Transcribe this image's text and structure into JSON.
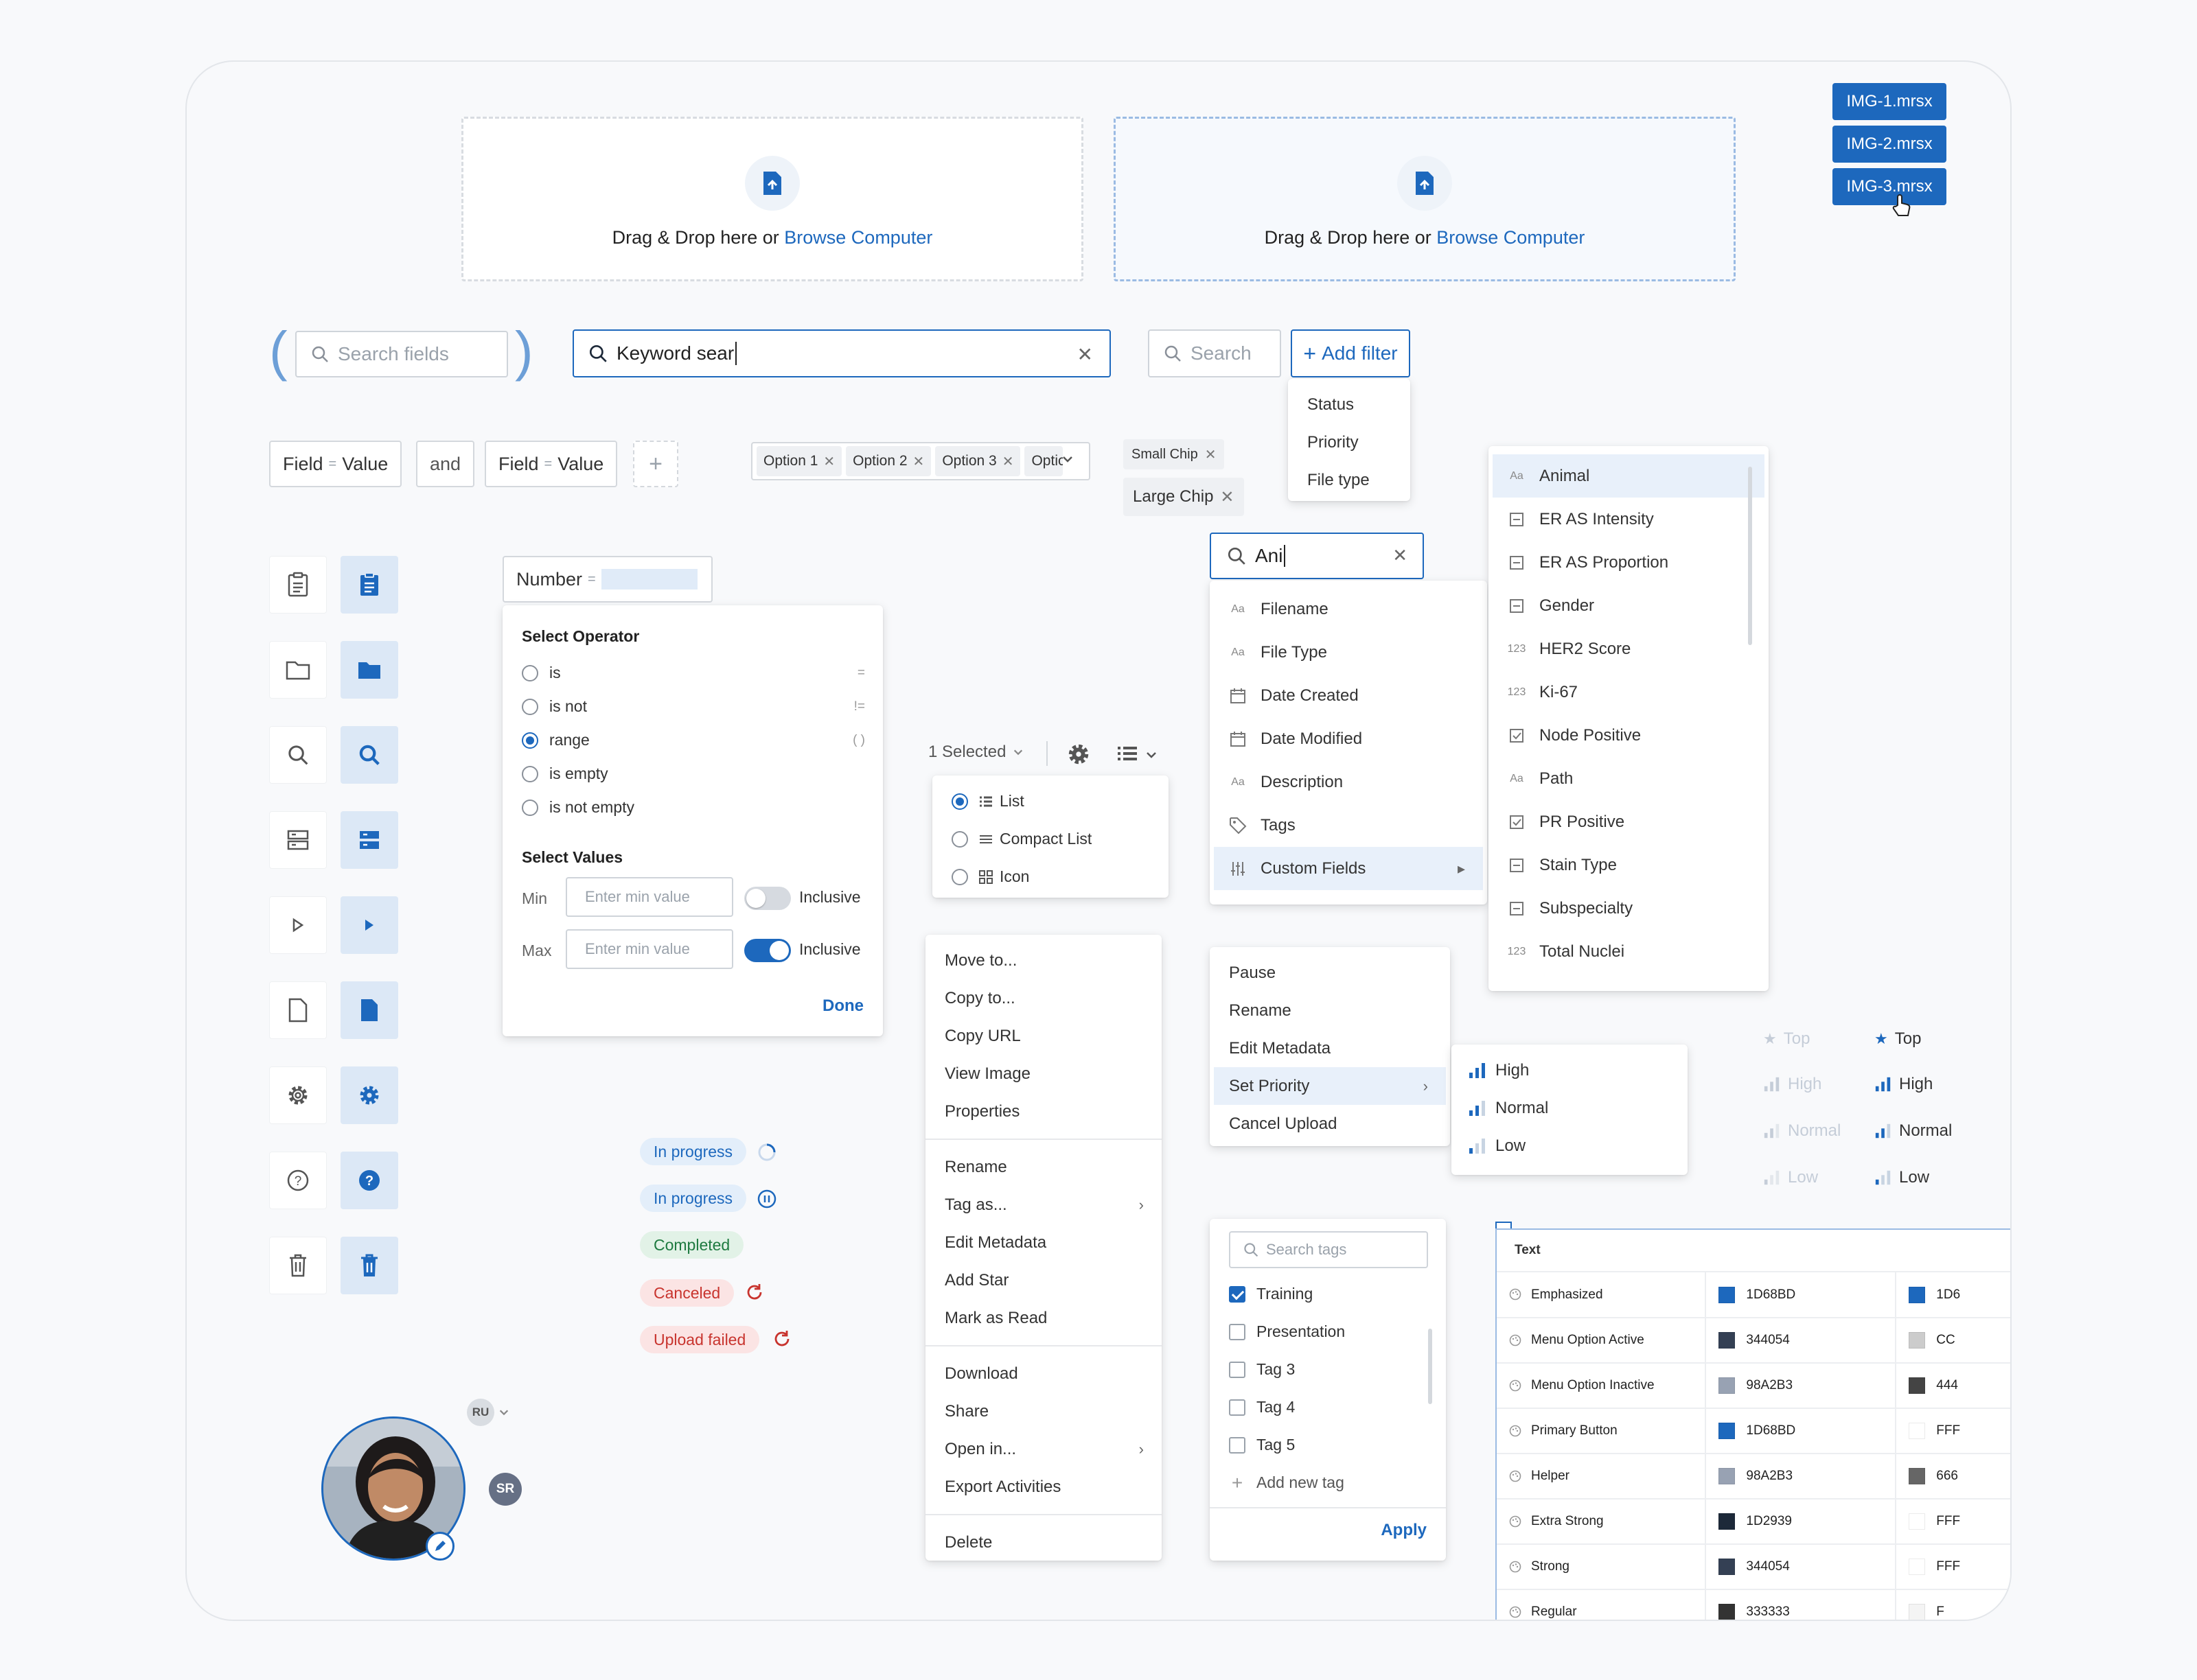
{
  "upload": {
    "prompt": "Drag & Drop here or",
    "browse": "Browse Computer",
    "files": [
      "IMG-1.mrsx",
      "IMG-2.mrsx",
      "IMG-3.mrsx"
    ]
  },
  "search": {
    "fields_placeholder": "Search fields",
    "keyword_value": "Keyword sear",
    "small_placeholder": "Search",
    "add_filter": "Add filter",
    "filter_options": [
      "Status",
      "Priority",
      "File type"
    ]
  },
  "query": {
    "field": "Field",
    "eq": "=",
    "value": "Value",
    "and": "and",
    "plus": "+"
  },
  "options": [
    "Option 1",
    "Option 2",
    "Option 3",
    "Optic"
  ],
  "chips": {
    "small": "Small Chip",
    "large": "Large Chip"
  },
  "number_filter": {
    "label": "Number",
    "eq": "=",
    "operator_title": "Select Operator",
    "operators": [
      {
        "label": "is",
        "sym": "="
      },
      {
        "label": "is not",
        "sym": "!="
      },
      {
        "label": "range",
        "sym": "( )"
      },
      {
        "label": "is empty",
        "sym": ""
      },
      {
        "label": "is not empty",
        "sym": ""
      }
    ],
    "values_title": "Select Values",
    "min_label": "Min",
    "max_label": "Max",
    "min_placeholder": "Enter min value",
    "max_placeholder": "Enter min value",
    "inclusive": "Inclusive",
    "done": "Done"
  },
  "view": {
    "selected": "1 Selected",
    "options": [
      "List",
      "Compact List",
      "Icon"
    ]
  },
  "context_menu": {
    "group1": [
      "Move to...",
      "Copy to...",
      "Copy URL",
      "View Image",
      "Properties"
    ],
    "group2": [
      "Rename",
      "Tag as...",
      "Edit Metadata",
      "Add Star",
      "Mark as Read"
    ],
    "group3": [
      "Download",
      "Share",
      "Open in...",
      "Export Activities"
    ],
    "group4": [
      "Delete"
    ]
  },
  "field_search": {
    "value": "Ani",
    "items": [
      "Filename",
      "File Type",
      "Date Created",
      "Date Modified",
      "Description",
      "Tags",
      "Custom Fields"
    ]
  },
  "custom_fields": [
    "Animal",
    "ER AS Intensity",
    "ER AS Proportion",
    "Gender",
    "HER2 Score",
    "Ki-67",
    "Node Positive",
    "Path",
    "PR Positive",
    "Stain Type",
    "Subspecialty",
    "Total Nuclei"
  ],
  "upload_menu": [
    "Pause",
    "Rename",
    "Edit Metadata",
    "Set Priority",
    "Cancel Upload"
  ],
  "priority": [
    "High",
    "Normal",
    "Low"
  ],
  "legend": {
    "top": "Top",
    "high": "High",
    "normal": "Normal",
    "low": "Low"
  },
  "tags": {
    "placeholder": "Search tags",
    "items": [
      "Training",
      "Presentation",
      "Tag 3",
      "Tag 4",
      "Tag 5"
    ],
    "add": "Add new tag",
    "apply": "Apply"
  },
  "status": {
    "in_progress": "In progress",
    "completed": "Completed",
    "canceled": "Canceled",
    "failed": "Upload failed"
  },
  "avatars": {
    "ru": "RU",
    "sr": "SR"
  },
  "tokens": {
    "header": "Text",
    "rows": [
      {
        "name": "Emphasized",
        "c1": "1D68BD",
        "h1": "#1d68bd",
        "c2": "1D6",
        "h2": "#1d68bd"
      },
      {
        "name": "Menu Option Active",
        "c1": "344054",
        "h1": "#344054",
        "c2": "CC",
        "h2": "#cccccc"
      },
      {
        "name": "Menu Option Inactive",
        "c1": "98A2B3",
        "h1": "#98a2b3",
        "c2": "444",
        "h2": "#444444"
      },
      {
        "name": "Primary Button",
        "c1": "1D68BD",
        "h1": "#1d68bd",
        "c2": "FFF",
        "h2": "#ffffff"
      },
      {
        "name": "Helper",
        "c1": "98A2B3",
        "h1": "#98a2b3",
        "c2": "666",
        "h2": "#666666"
      },
      {
        "name": "Extra Strong",
        "c1": "1D2939",
        "h1": "#1d2939",
        "c2": "FFF",
        "h2": "#ffffff"
      },
      {
        "name": "Strong",
        "c1": "344054",
        "h1": "#344054",
        "c2": "FFF",
        "h2": "#ffffff"
      },
      {
        "name": "Regular",
        "c1": "333333",
        "h1": "#333333",
        "c2": "F",
        "h2": "#f4f4f4"
      }
    ]
  },
  "colors": {
    "accent": "#1d68bd",
    "highlight": "#e8f0fa"
  }
}
